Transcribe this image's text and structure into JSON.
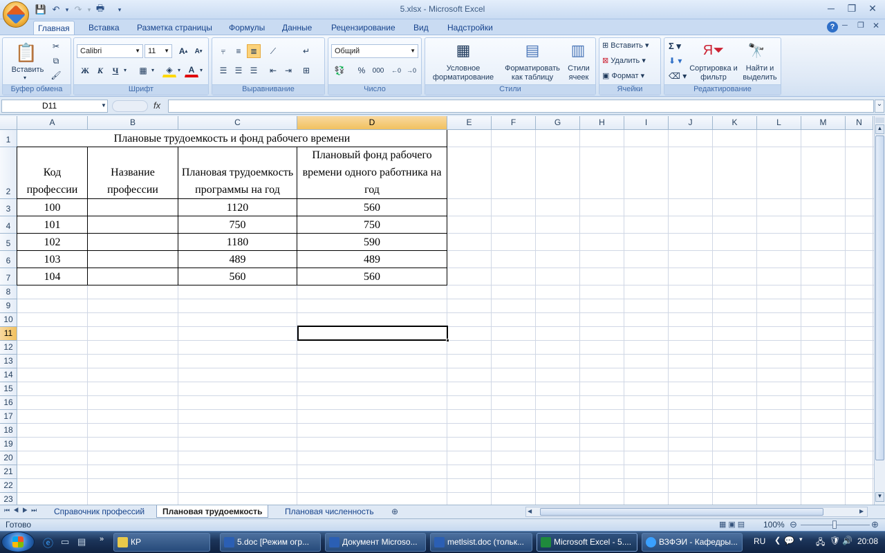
{
  "window": {
    "title": "5.xlsx - Microsoft Excel"
  },
  "ribbon_tabs": [
    "Главная",
    "Вставка",
    "Разметка страницы",
    "Формулы",
    "Данные",
    "Рецензирование",
    "Вид",
    "Надстройки"
  ],
  "ribbon": {
    "clipboard": {
      "paste": "Вставить",
      "label": "Буфер обмена"
    },
    "font": {
      "name": "Calibri",
      "size": "11",
      "bold": "Ж",
      "italic": "К",
      "underline": "Ч",
      "label": "Шрифт"
    },
    "alignment": {
      "label": "Выравнивание"
    },
    "number": {
      "format": "Общий",
      "label": "Число"
    },
    "styles": {
      "conditional": "Условное форматирование",
      "table": "Форматировать как таблицу",
      "cell_styles": "Стили ячеек",
      "label": "Стили"
    },
    "cells": {
      "insert": "Вставить",
      "delete": "Удалить",
      "format": "Формат",
      "label": "Ячейки"
    },
    "editing": {
      "sort": "Сортировка и фильтр",
      "find": "Найти и выделить",
      "label": "Редактирование"
    }
  },
  "formula_bar": {
    "name_box": "D11",
    "fx": "fx",
    "value": ""
  },
  "columns": [
    "A",
    "B",
    "C",
    "D",
    "E",
    "F",
    "G",
    "H",
    "I",
    "J",
    "K",
    "L",
    "M",
    "N"
  ],
  "selected_column": "D",
  "selected_row": "11",
  "rows": [
    "1",
    "2",
    "3",
    "4",
    "5",
    "6",
    "7",
    "8",
    "9",
    "10",
    "11",
    "12",
    "13",
    "14",
    "15",
    "16",
    "17",
    "18",
    "19",
    "20",
    "21",
    "22",
    "23"
  ],
  "sheet": {
    "title": "Плановые трудоемкость и фонд рабочего времени",
    "headers": [
      "Код профессии",
      "Название профессии",
      "Плановая трудоемкость программы на год",
      "Плановый фонд рабочего времени одного работника на год"
    ],
    "data": [
      [
        "100",
        "",
        "1120",
        "560"
      ],
      [
        "101",
        "",
        "750",
        "750"
      ],
      [
        "102",
        "",
        "1180",
        "590"
      ],
      [
        "103",
        "",
        "489",
        "489"
      ],
      [
        "104",
        "",
        "560",
        "560"
      ]
    ]
  },
  "sheet_tabs": [
    "Справочник профессий",
    "Плановая трудоемкость",
    "Плановая численность"
  ],
  "active_sheet_tab": "Плановая трудоемкость",
  "status": {
    "text": "Готово",
    "zoom": "100%"
  },
  "taskbar": {
    "items": [
      "КР",
      "5.doc [Режим огр...",
      "Документ Microso...",
      "metlsist.doc (тольк...",
      "Microsoft Excel - 5....",
      "ВЗФЭИ - Кафедры..."
    ],
    "active": "Microsoft Excel - 5....",
    "lang": "RU",
    "time": "20:08"
  }
}
